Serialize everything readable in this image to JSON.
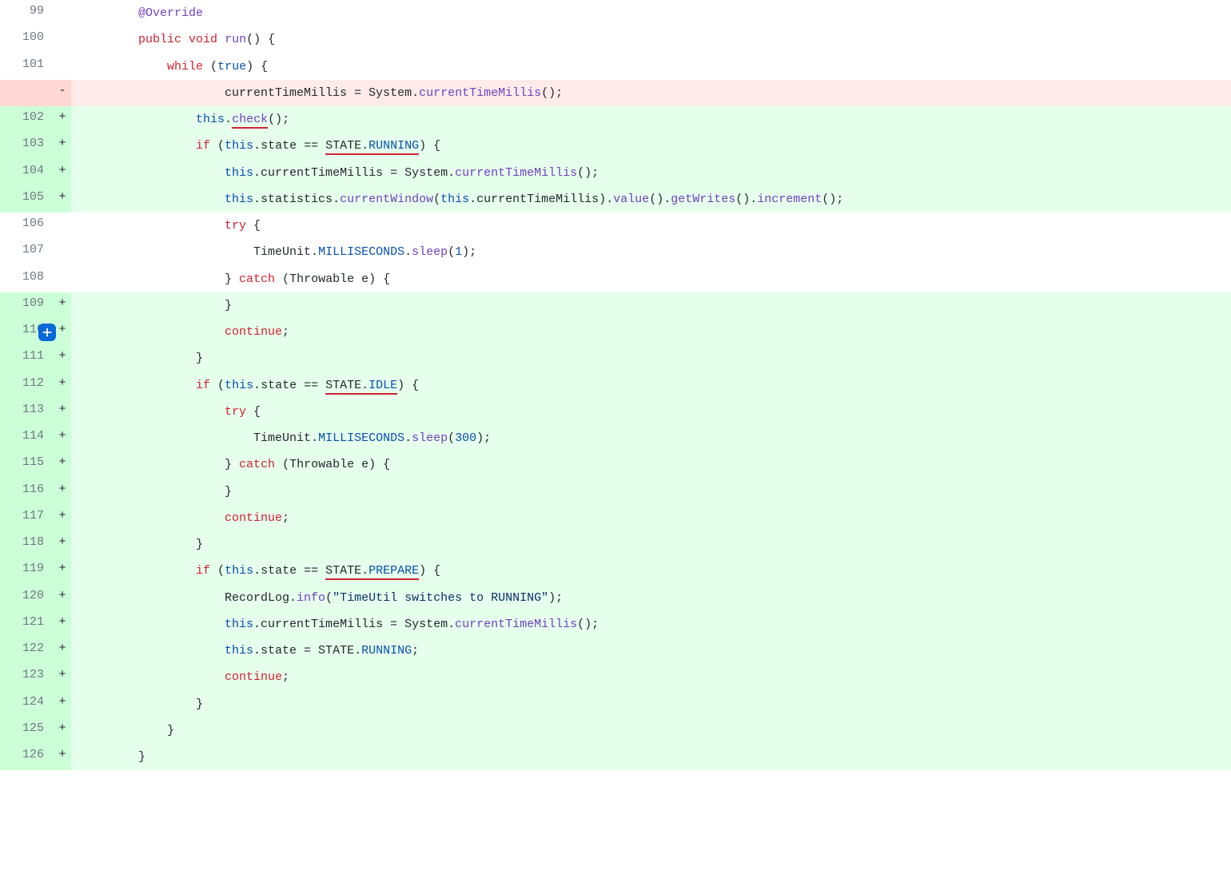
{
  "diff": [
    {
      "num": "99",
      "bg": "ctx",
      "mk": "",
      "tokens": [
        [
          "tok-plain",
          "        "
        ],
        [
          "tok-annot",
          "@Override"
        ]
      ]
    },
    {
      "num": "100",
      "bg": "ctx",
      "mk": "",
      "tokens": [
        [
          "tok-plain",
          "        "
        ],
        [
          "tok-kw",
          "public"
        ],
        [
          "tok-plain",
          " "
        ],
        [
          "tok-kw",
          "void"
        ],
        [
          "tok-plain",
          " "
        ],
        [
          "tok-fn",
          "run"
        ],
        [
          "tok-plain",
          "() {"
        ]
      ]
    },
    {
      "num": "101",
      "bg": "ctx",
      "mk": "",
      "tokens": [
        [
          "tok-plain",
          "            "
        ],
        [
          "tok-kw",
          "while"
        ],
        [
          "tok-plain",
          " ("
        ],
        [
          "tok-kwblue",
          "true"
        ],
        [
          "tok-plain",
          ") {"
        ]
      ]
    },
    {
      "num": "",
      "bg": "del",
      "mk": "-",
      "tokens": [
        [
          "tok-plain",
          "                    currentTimeMillis = System."
        ],
        [
          "tok-fn",
          "currentTimeMillis"
        ],
        [
          "tok-plain",
          "();"
        ]
      ]
    },
    {
      "num": "102",
      "bg": "add",
      "mk": "+",
      "tokens": [
        [
          "tok-plain",
          "                "
        ],
        [
          "tok-kwblue",
          "this"
        ],
        [
          "tok-plain",
          "."
        ],
        [
          "tok-fn red-u",
          "check"
        ],
        [
          "tok-plain",
          "();"
        ]
      ]
    },
    {
      "num": "103",
      "bg": "add",
      "mk": "+",
      "tokens": [
        [
          "tok-plain",
          "                "
        ],
        [
          "tok-kw",
          "if"
        ],
        [
          "tok-plain",
          " ("
        ],
        [
          "tok-kwblue",
          "this"
        ],
        [
          "tok-plain",
          ".state == "
        ],
        [
          "tok-plain red-u",
          "STATE"
        ],
        [
          "tok-plain red-u",
          "."
        ],
        [
          "tok-const red-u",
          "RUNNING"
        ],
        [
          "tok-plain",
          ") {"
        ]
      ]
    },
    {
      "num": "104",
      "bg": "add",
      "mk": "+",
      "tokens": [
        [
          "tok-plain",
          "                    "
        ],
        [
          "tok-kwblue",
          "this"
        ],
        [
          "tok-plain",
          ".currentTimeMillis = System."
        ],
        [
          "tok-fn",
          "currentTimeMillis"
        ],
        [
          "tok-plain",
          "();"
        ]
      ]
    },
    {
      "num": "105",
      "bg": "add",
      "mk": "+",
      "tokens": [
        [
          "tok-plain",
          "                    "
        ],
        [
          "tok-kwblue",
          "this"
        ],
        [
          "tok-plain",
          ".statistics."
        ],
        [
          "tok-fn",
          "currentWindow"
        ],
        [
          "tok-plain",
          "("
        ],
        [
          "tok-kwblue",
          "this"
        ],
        [
          "tok-plain",
          ".currentTimeMillis)."
        ],
        [
          "tok-fn",
          "value"
        ],
        [
          "tok-plain",
          "()."
        ],
        [
          "tok-fn",
          "getWrites"
        ],
        [
          "tok-plain",
          "()."
        ],
        [
          "tok-fn",
          "increment"
        ],
        [
          "tok-plain",
          "();"
        ]
      ]
    },
    {
      "num": "106",
      "bg": "ctx",
      "mk": "",
      "tokens": [
        [
          "tok-plain",
          "                    "
        ],
        [
          "tok-kw",
          "try"
        ],
        [
          "tok-plain",
          " {"
        ]
      ]
    },
    {
      "num": "107",
      "bg": "ctx",
      "mk": "",
      "tokens": [
        [
          "tok-plain",
          "                        TimeUnit."
        ],
        [
          "tok-const",
          "MILLISECONDS"
        ],
        [
          "tok-plain",
          "."
        ],
        [
          "tok-fn",
          "sleep"
        ],
        [
          "tok-plain",
          "("
        ],
        [
          "tok-num",
          "1"
        ],
        [
          "tok-plain",
          ");"
        ]
      ]
    },
    {
      "num": "108",
      "bg": "ctx",
      "mk": "",
      "tokens": [
        [
          "tok-plain",
          "                    } "
        ],
        [
          "tok-kw",
          "catch"
        ],
        [
          "tok-plain",
          " (Throwable e) {"
        ]
      ]
    },
    {
      "num": "109",
      "bg": "add",
      "mk": "+",
      "tokens": [
        [
          "tok-plain",
          "                    }"
        ]
      ]
    },
    {
      "num": "110",
      "bg": "add",
      "mk": "+",
      "tokens": [
        [
          "tok-plain",
          "                    "
        ],
        [
          "tok-kw",
          "continue"
        ],
        [
          "tok-plain",
          ";"
        ]
      ],
      "addBtn": true
    },
    {
      "num": "111",
      "bg": "add",
      "mk": "+",
      "tokens": [
        [
          "tok-plain",
          "                }"
        ]
      ]
    },
    {
      "num": "112",
      "bg": "add",
      "mk": "+",
      "tokens": [
        [
          "tok-plain",
          "                "
        ],
        [
          "tok-kw",
          "if"
        ],
        [
          "tok-plain",
          " ("
        ],
        [
          "tok-kwblue",
          "this"
        ],
        [
          "tok-plain",
          ".state == "
        ],
        [
          "tok-plain red-u",
          "STATE"
        ],
        [
          "tok-plain red-u",
          "."
        ],
        [
          "tok-const red-u",
          "IDLE"
        ],
        [
          "tok-plain",
          ") {"
        ]
      ]
    },
    {
      "num": "113",
      "bg": "add",
      "mk": "+",
      "tokens": [
        [
          "tok-plain",
          "                    "
        ],
        [
          "tok-kw",
          "try"
        ],
        [
          "tok-plain",
          " {"
        ]
      ]
    },
    {
      "num": "114",
      "bg": "add",
      "mk": "+",
      "tokens": [
        [
          "tok-plain",
          "                        TimeUnit."
        ],
        [
          "tok-const",
          "MILLISECONDS"
        ],
        [
          "tok-plain",
          "."
        ],
        [
          "tok-fn",
          "sleep"
        ],
        [
          "tok-plain",
          "("
        ],
        [
          "tok-num",
          "300"
        ],
        [
          "tok-plain",
          ");"
        ]
      ]
    },
    {
      "num": "115",
      "bg": "add",
      "mk": "+",
      "tokens": [
        [
          "tok-plain",
          "                    } "
        ],
        [
          "tok-kw",
          "catch"
        ],
        [
          "tok-plain",
          " (Throwable e) {"
        ]
      ]
    },
    {
      "num": "116",
      "bg": "add",
      "mk": "+",
      "tokens": [
        [
          "tok-plain",
          "                    }"
        ]
      ]
    },
    {
      "num": "117",
      "bg": "add",
      "mk": "+",
      "tokens": [
        [
          "tok-plain",
          "                    "
        ],
        [
          "tok-kw",
          "continue"
        ],
        [
          "tok-plain",
          ";"
        ]
      ]
    },
    {
      "num": "118",
      "bg": "add",
      "mk": "+",
      "tokens": [
        [
          "tok-plain",
          "                }"
        ]
      ]
    },
    {
      "num": "119",
      "bg": "add",
      "mk": "+",
      "tokens": [
        [
          "tok-plain",
          "                "
        ],
        [
          "tok-kw",
          "if"
        ],
        [
          "tok-plain",
          " ("
        ],
        [
          "tok-kwblue",
          "this"
        ],
        [
          "tok-plain",
          ".state == "
        ],
        [
          "tok-plain red-u",
          "STATE"
        ],
        [
          "tok-plain red-u",
          "."
        ],
        [
          "tok-const red-u",
          "PREPARE"
        ],
        [
          "tok-plain",
          ") {"
        ]
      ]
    },
    {
      "num": "120",
      "bg": "add",
      "mk": "+",
      "tokens": [
        [
          "tok-plain",
          "                    RecordLog."
        ],
        [
          "tok-fn",
          "info"
        ],
        [
          "tok-plain",
          "("
        ],
        [
          "tok-str",
          "\"TimeUtil switches to RUNNING\""
        ],
        [
          "tok-plain",
          ");"
        ]
      ]
    },
    {
      "num": "121",
      "bg": "add",
      "mk": "+",
      "tokens": [
        [
          "tok-plain",
          "                    "
        ],
        [
          "tok-kwblue",
          "this"
        ],
        [
          "tok-plain",
          ".currentTimeMillis = System."
        ],
        [
          "tok-fn",
          "currentTimeMillis"
        ],
        [
          "tok-plain",
          "();"
        ]
      ]
    },
    {
      "num": "122",
      "bg": "add",
      "mk": "+",
      "tokens": [
        [
          "tok-plain",
          "                    "
        ],
        [
          "tok-kwblue",
          "this"
        ],
        [
          "tok-plain",
          ".state = STATE."
        ],
        [
          "tok-const",
          "RUNNING"
        ],
        [
          "tok-plain",
          ";"
        ]
      ]
    },
    {
      "num": "123",
      "bg": "add",
      "mk": "+",
      "tokens": [
        [
          "tok-plain",
          "                    "
        ],
        [
          "tok-kw",
          "continue"
        ],
        [
          "tok-plain",
          ";"
        ]
      ]
    },
    {
      "num": "124",
      "bg": "add",
      "mk": "+",
      "tokens": [
        [
          "tok-plain",
          "                }"
        ]
      ]
    },
    {
      "num": "125",
      "bg": "add",
      "mk": "+",
      "tokens": [
        [
          "tok-plain",
          "            }"
        ]
      ]
    },
    {
      "num": "126",
      "bg": "add",
      "mk": "+",
      "tokens": [
        [
          "tok-plain",
          "        }"
        ]
      ]
    }
  ]
}
